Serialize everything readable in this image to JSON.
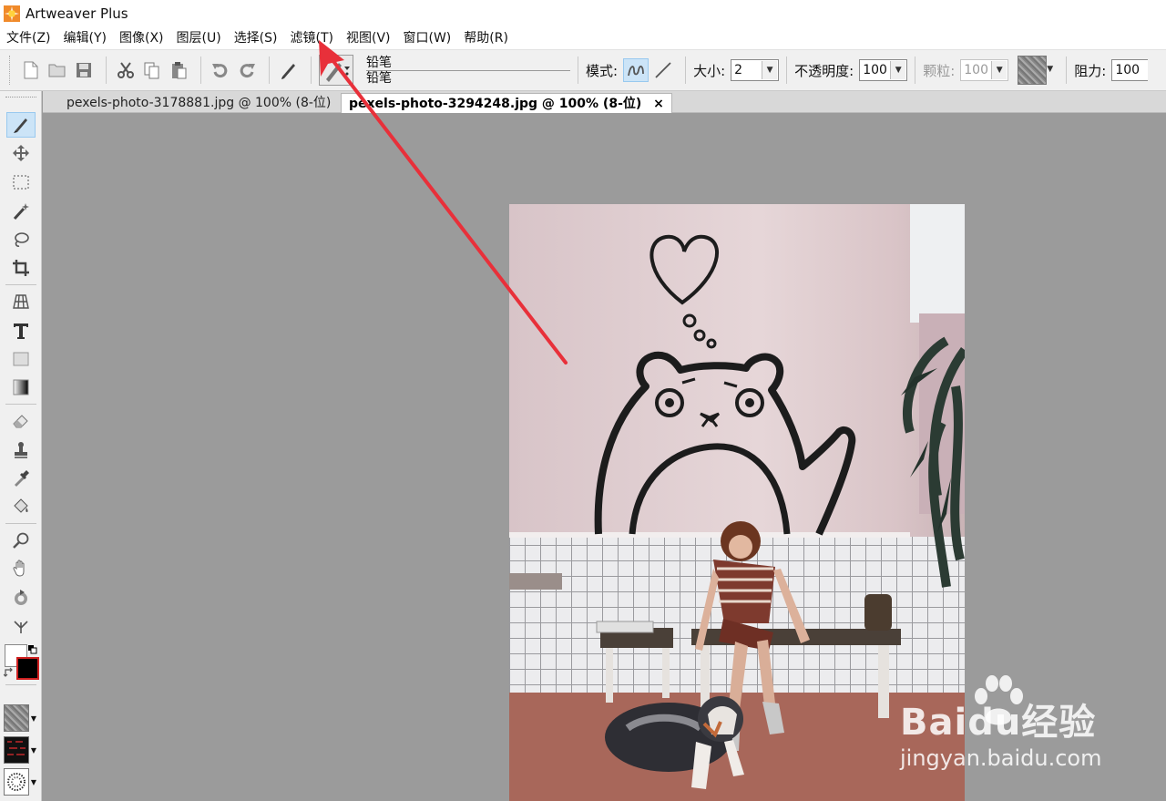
{
  "window": {
    "title": "Artweaver Plus"
  },
  "menu": [
    "文件(Z)",
    "编辑(Y)",
    "图像(X)",
    "图层(U)",
    "选择(S)",
    "滤镜(T)",
    "视图(V)",
    "窗口(W)",
    "帮助(R)"
  ],
  "toolbar": {
    "preset_name_top": "铅笔",
    "preset_name_bottom": "铅笔",
    "mode_label": "模式:",
    "size_label": "大小:",
    "size_value": "2",
    "opacity_label": "不透明度:",
    "opacity_value": "100",
    "grain_label": "颗粒:",
    "grain_value": "100",
    "resistance_label": "阻力:",
    "resistance_value": "100"
  },
  "tabs": [
    {
      "label": "pexels-photo-3178881.jpg @ 100% (8-位)",
      "active": false
    },
    {
      "label": "pexels-photo-3294248.jpg @ 100% (8-位)",
      "active": true,
      "close": "×"
    }
  ],
  "tools": [
    "brush-tool",
    "move-tool",
    "rect-select-tool",
    "magic-wand-tool",
    "lasso-tool",
    "crop-tool",
    "perspective-tool",
    "text-tool",
    "shape-tool",
    "gradient-tool",
    "eraser-tool",
    "clone-stamp-tool",
    "eyedropper-tool",
    "paint-bucket-tool",
    "zoom-tool",
    "hand-tool",
    "rotate-tool",
    "symmetry-tool"
  ],
  "colors": {
    "foreground": "#000000",
    "background": "#ffffff",
    "annotation_arrow": "#e8303a",
    "accent": "#cce4f7"
  },
  "watermark": {
    "brand": "Baidu经验",
    "url": "jingyan.baidu.com"
  }
}
